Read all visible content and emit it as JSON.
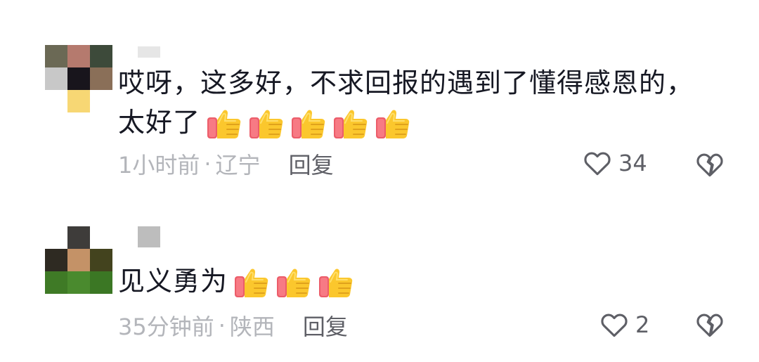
{
  "comments": [
    {
      "text": "哎呀，这多好，不求回报的遇到了懂得感恩的，太好了",
      "thumbs_count": 5,
      "time": "1小时前",
      "location": "辽宁",
      "reply_label": "回复",
      "likes": "34"
    },
    {
      "text": "见义勇为",
      "thumbs_count": 3,
      "time": "35分钟前",
      "location": "陕西",
      "reply_label": "回复",
      "likes": "2"
    }
  ],
  "separator": "·",
  "icons": {
    "like": "heart-outline-icon",
    "dislike": "broken-heart-icon",
    "emoji": "thumbs-up-emoji"
  },
  "colors": {
    "text": "#161823",
    "meta": "#b3b5ba",
    "action": "#5e5f66"
  }
}
